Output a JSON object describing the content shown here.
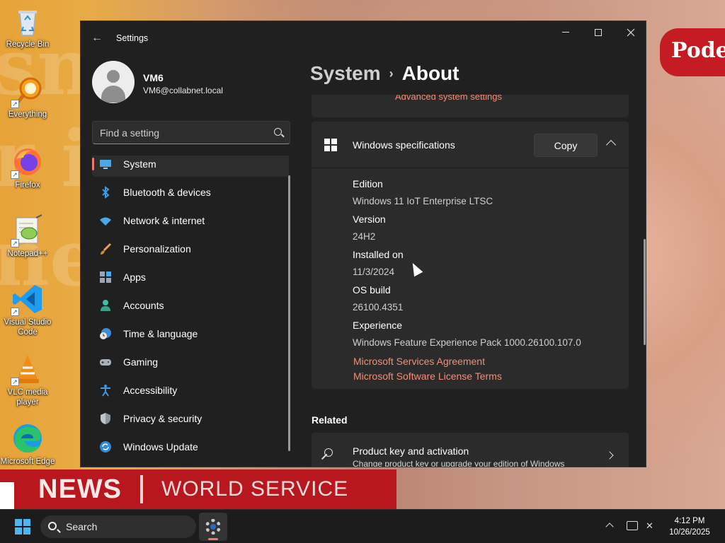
{
  "wallpaper": {
    "badge_text": "Pode",
    "news_word_1": "NEWS",
    "news_word_2": "WORLD SERVICE"
  },
  "desktop_icons": [
    {
      "label": "Recycle Bin",
      "icon": "recycle-bin-icon"
    },
    {
      "label": "Everything",
      "icon": "everything-search-icon"
    },
    {
      "label": "Firefox",
      "icon": "firefox-icon"
    },
    {
      "label": "Notepad++",
      "icon": "notepad-plus-plus-icon"
    },
    {
      "label": "Visual Studio Code",
      "icon": "vscode-icon"
    },
    {
      "label": "VLC media player",
      "icon": "vlc-icon"
    },
    {
      "label": "Microsoft Edge",
      "icon": "edge-icon"
    }
  ],
  "window": {
    "title": "Settings",
    "back_icon": "back-arrow-icon"
  },
  "profile": {
    "name": "VM6",
    "email": "VM6@collabnet.local"
  },
  "search": {
    "placeholder": "Find a setting"
  },
  "nav": {
    "active": "System",
    "items": [
      {
        "label": "System",
        "icon": "system-icon"
      },
      {
        "label": "Bluetooth & devices",
        "icon": "bluetooth-icon"
      },
      {
        "label": "Network & internet",
        "icon": "wifi-icon"
      },
      {
        "label": "Personalization",
        "icon": "brush-icon"
      },
      {
        "label": "Apps",
        "icon": "apps-icon"
      },
      {
        "label": "Accounts",
        "icon": "accounts-icon"
      },
      {
        "label": "Time & language",
        "icon": "globe-clock-icon"
      },
      {
        "label": "Gaming",
        "icon": "gamepad-icon"
      },
      {
        "label": "Accessibility",
        "icon": "accessibility-icon"
      },
      {
        "label": "Privacy & security",
        "icon": "shield-icon"
      },
      {
        "label": "Windows Update",
        "icon": "update-icon"
      }
    ]
  },
  "breadcrumb": {
    "parent": "System",
    "separator": "›",
    "current": "About"
  },
  "content": {
    "advanced_link": "Advanced system settings",
    "specs": {
      "title": "Windows specifications",
      "copy_label": "Copy",
      "rows": [
        {
          "key": "Edition",
          "value": "Windows 11 IoT Enterprise LTSC"
        },
        {
          "key": "Version",
          "value": "24H2"
        },
        {
          "key": "Installed on",
          "value": "11/3/2024"
        },
        {
          "key": "OS build",
          "value": "26100.4351"
        },
        {
          "key": "Experience",
          "value": "Windows Feature Experience Pack 1000.26100.107.0"
        }
      ],
      "links": [
        "Microsoft Services Agreement",
        "Microsoft Software License Terms"
      ]
    },
    "related_heading": "Related",
    "product_key": {
      "title": "Product key and activation",
      "subtitle": "Change product key or upgrade your edition of Windows"
    }
  },
  "taskbar": {
    "search_label": "Search",
    "time": "4:12 PM",
    "date": "10/26/2025"
  },
  "colors": {
    "accent": "#f2786f",
    "link": "#f08f7a",
    "window_bg": "#202020",
    "card_bg": "#2b2b2b"
  }
}
